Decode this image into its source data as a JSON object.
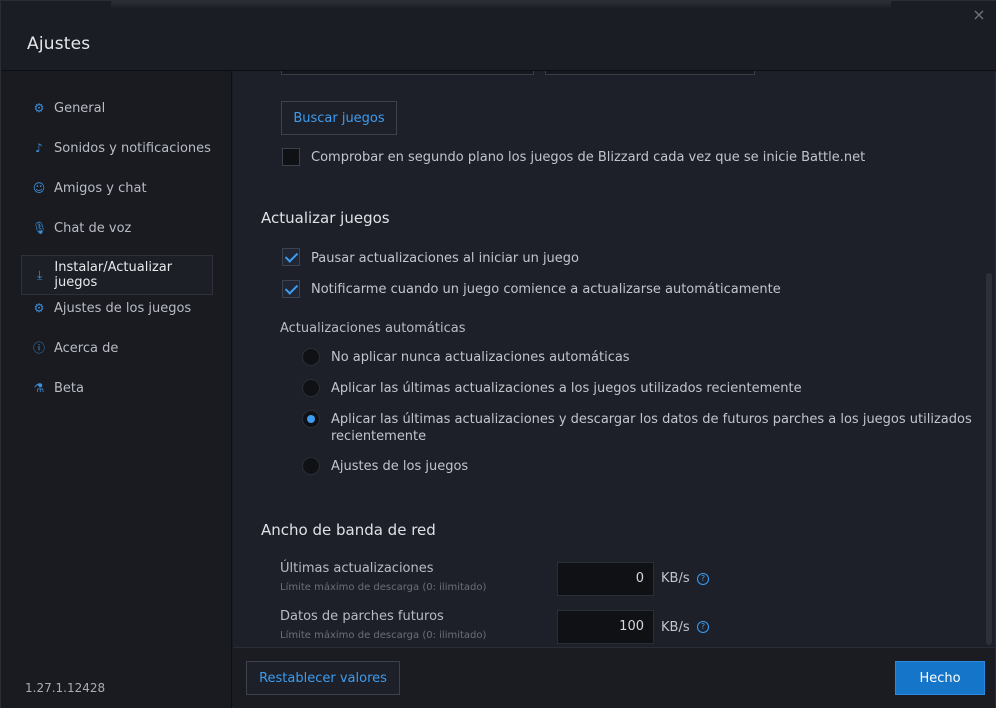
{
  "window": {
    "title": "Ajustes",
    "close_glyph": "×"
  },
  "sidebar": {
    "items": [
      {
        "label": "General",
        "icon": "gear-icon",
        "glyph": "⚙"
      },
      {
        "label": "Sonidos y notificaciones",
        "icon": "notification-icon",
        "glyph": "♪"
      },
      {
        "label": "Amigos y chat",
        "icon": "friends-icon",
        "glyph": "☺"
      },
      {
        "label": "Chat de voz",
        "icon": "microphone-icon",
        "glyph": "🎙"
      },
      {
        "label": "Instalar/Actualizar juegos",
        "icon": "download-icon",
        "glyph": "⤓",
        "active": true
      },
      {
        "label": "Ajustes de los juegos",
        "icon": "game-settings-icon",
        "glyph": "⚙"
      },
      {
        "label": "Acerca de",
        "icon": "info-icon",
        "glyph": "ⓘ"
      },
      {
        "label": "Beta",
        "icon": "flask-icon",
        "glyph": "⚗"
      }
    ],
    "version": "1.27.1.12428"
  },
  "scan": {
    "button_label": "Buscar juegos",
    "background_check_label": "Comprobar en segundo plano los juegos de Blizzard cada vez que se inicie Battle.net",
    "background_check_checked": false
  },
  "updates": {
    "heading": "Actualizar juegos",
    "pause_label": "Pausar actualizaciones al iniciar un juego",
    "pause_checked": true,
    "notify_label": "Notificarme cuando un juego comience a actualizarse automáticamente",
    "notify_checked": true,
    "auto_heading": "Actualizaciones automáticas",
    "auto_options": [
      {
        "label": "No aplicar nunca actualizaciones automáticas",
        "selected": false
      },
      {
        "label": "Aplicar las últimas actualizaciones a los juegos utilizados recientemente",
        "selected": false
      },
      {
        "label_line1": "Aplicar las últimas actualizaciones y descargar los datos de futuros parches a los juegos utilizados",
        "label_line2": "recientemente",
        "selected": true
      },
      {
        "label": "Ajustes de los juegos",
        "selected": false
      }
    ]
  },
  "bandwidth": {
    "heading": "Ancho de banda de red",
    "latest": {
      "label": "Últimas actualizaciones",
      "hint": "Límite máximo de descarga (0: ilimitado)",
      "value": "0",
      "unit": "KB/s"
    },
    "future": {
      "label": "Datos de parches futuros",
      "hint": "Límite máximo de descarga (0: ilimitado)",
      "value": "100",
      "unit": "KB/s"
    },
    "help_glyph": "?"
  },
  "footer": {
    "reset_label": "Restablecer valores",
    "done_label": "Hecho"
  },
  "colors": {
    "accent": "#3d9cf0",
    "primary_button": "#1576c9",
    "background": "#1d2028",
    "sidebar": "#191b21"
  }
}
